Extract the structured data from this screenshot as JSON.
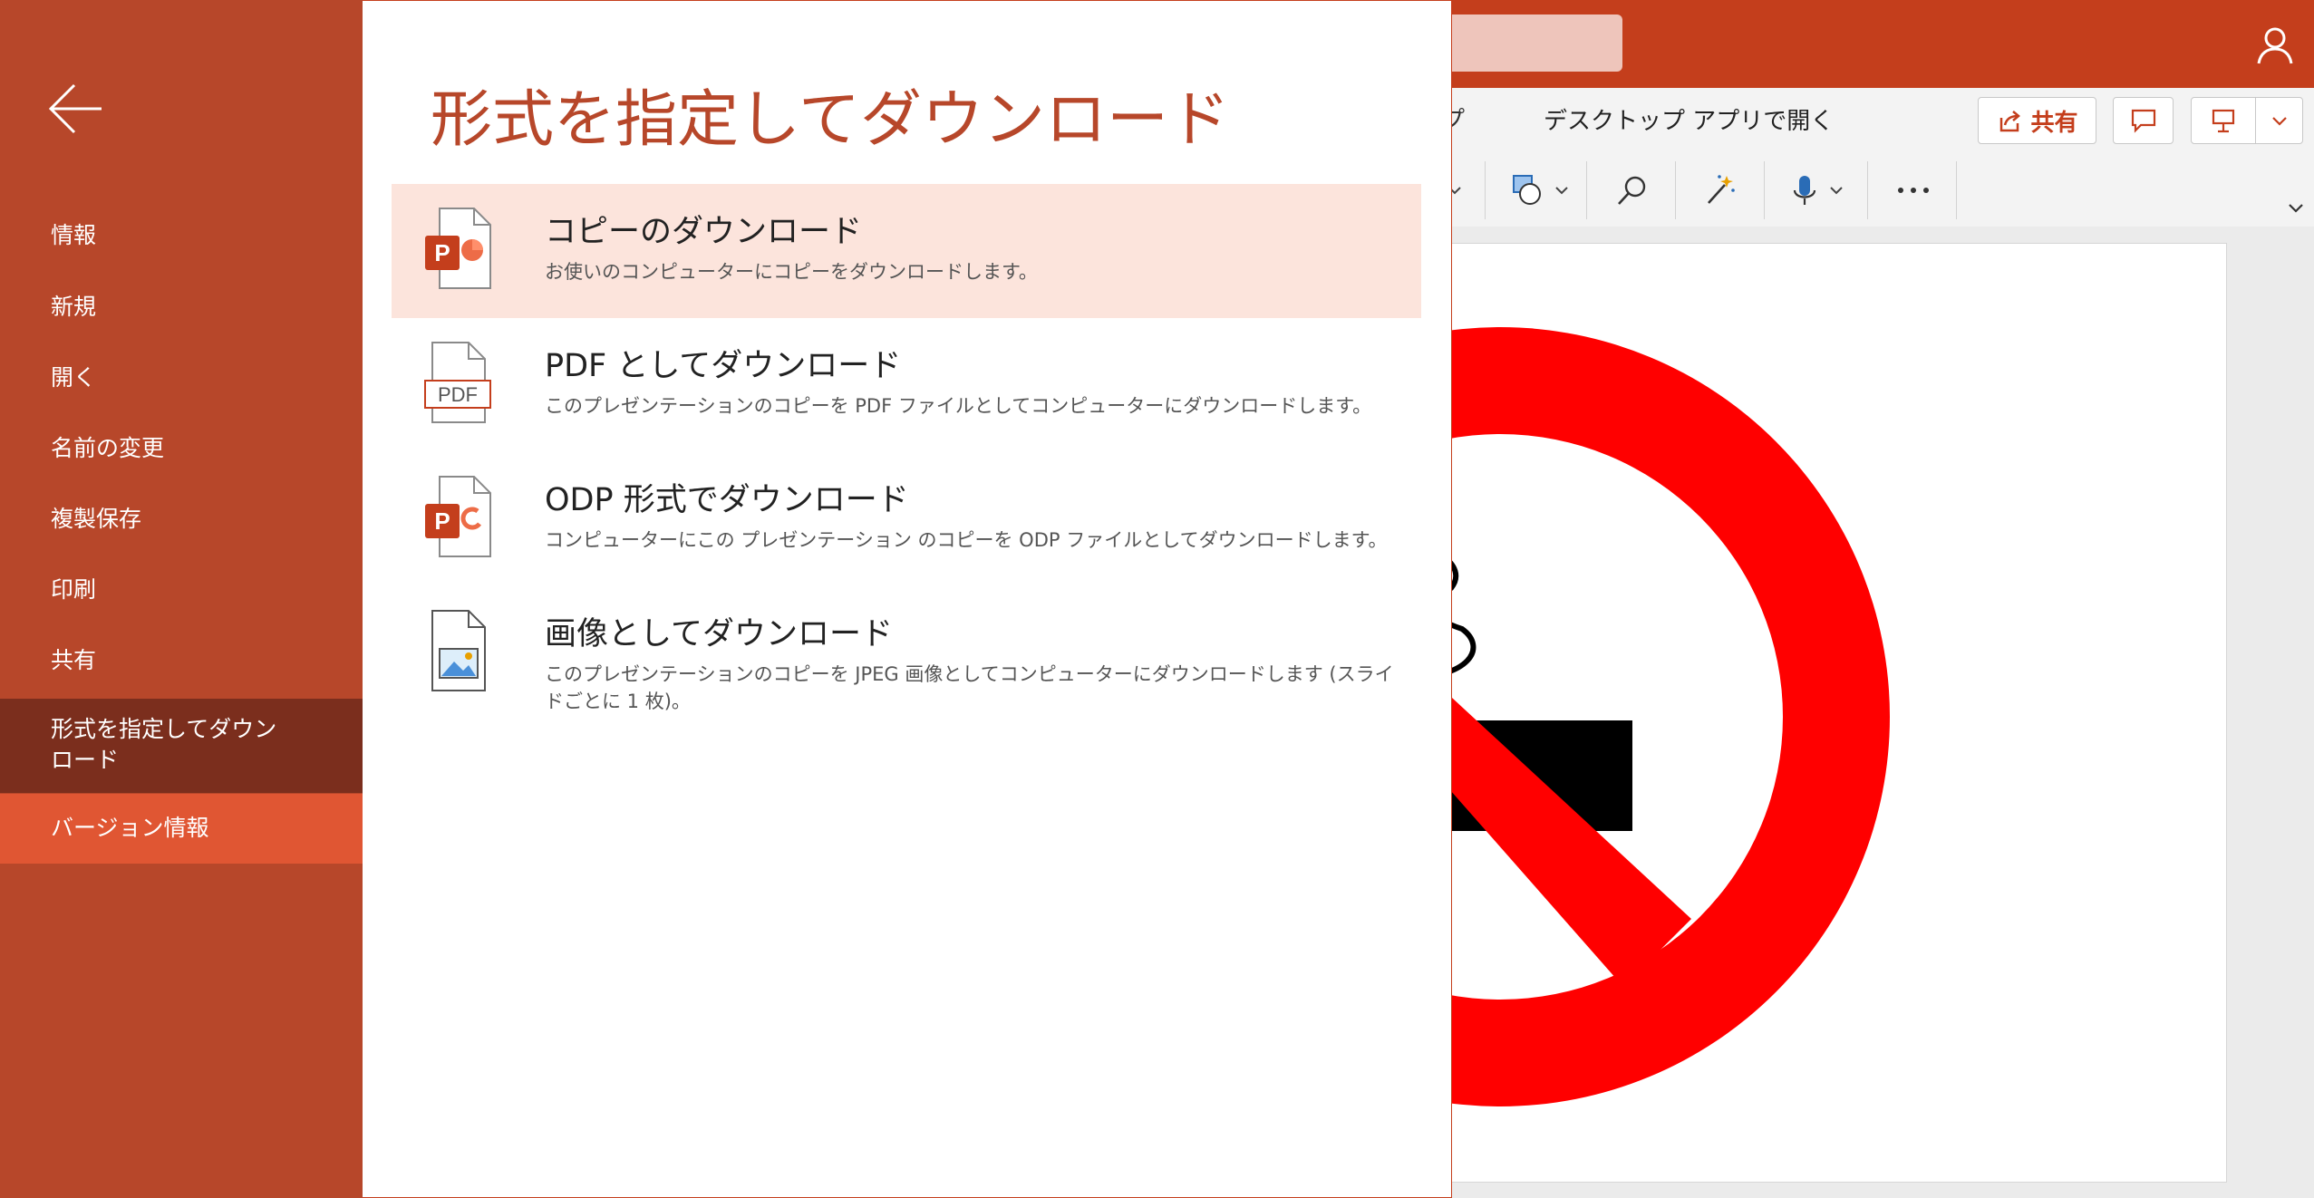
{
  "app": {
    "ribbon_tab_partial": "プ",
    "open_in_desktop": "デスクトップ アプリで開く",
    "share_label": "共有"
  },
  "nav": {
    "items": [
      {
        "label": "情報"
      },
      {
        "label": "新規"
      },
      {
        "label": "開く"
      },
      {
        "label": "名前の変更"
      },
      {
        "label": "複製保存"
      },
      {
        "label": "印刷"
      },
      {
        "label": "共有"
      },
      {
        "label": "形式を指定してダウンロード",
        "selected": true
      },
      {
        "label": "バージョン情報"
      }
    ]
  },
  "panel": {
    "title": "形式を指定してダウンロード",
    "options": [
      {
        "title": "コピーのダウンロード",
        "desc": "お使いのコンピューターにコピーをダウンロードします。",
        "icon": "pptx-file-icon"
      },
      {
        "title": "PDF としてダウンロード",
        "desc": "このプレゼンテーションのコピーを PDF ファイルとしてコンピューターにダウンロードします。",
        "icon": "pdf-file-icon",
        "icon_text": "PDF"
      },
      {
        "title": "ODP 形式でダウンロード",
        "desc": "コンピューターにこの プレゼンテーション のコピーを ODP ファイルとしてダウンロードします。",
        "icon": "odp-file-icon"
      },
      {
        "title": "画像としてダウンロード",
        "desc": "このプレゼンテーションのコピーを JPEG 画像としてコンピューターにダウンロードします (スライドごとに 1 枚)。",
        "icon": "image-file-icon"
      }
    ]
  },
  "colors": {
    "brand": "#c43e1c",
    "nav_bg": "#b7472a",
    "nav_selected": "#7b2e1d",
    "nav_hover": "#e05633",
    "title": "#b7472a",
    "highlight": "#fce4dc",
    "slide_sign_red": "#ff0000"
  }
}
